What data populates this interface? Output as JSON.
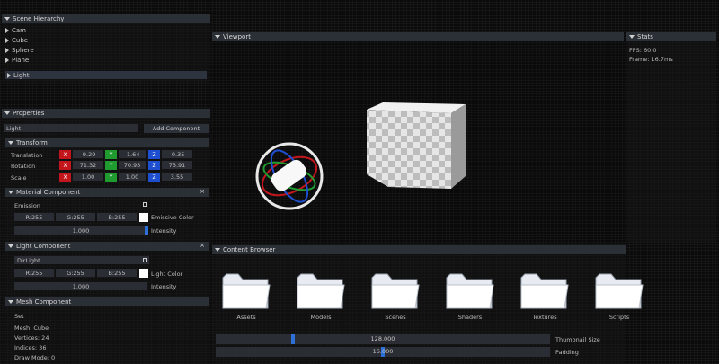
{
  "hierarchy": {
    "title": "Scene Hierarchy",
    "items": [
      "Cam",
      "Cube",
      "Sphere",
      "Plane",
      "Light"
    ]
  },
  "properties": {
    "title": "Properties",
    "object_name": "Light",
    "add_component": "Add Component",
    "transform": {
      "title": "Transform",
      "rows": [
        {
          "label": "Translation",
          "x": "-9.29",
          "y": "-1.64",
          "z": "-0.35"
        },
        {
          "label": "Rotation",
          "x": "71.32",
          "y": "70.93",
          "z": "73.91"
        },
        {
          "label": "Scale",
          "x": "1.00",
          "y": "1.00",
          "z": "3.55"
        }
      ]
    },
    "material": {
      "title": "Material Component",
      "emission_label": "Emission",
      "r": "R:255",
      "g": "G:255",
      "b": "B:255",
      "right_label": "Emissive Color",
      "value": "1.000",
      "value_label": "Intensity"
    },
    "light": {
      "title": "Light Component",
      "type": "DirLight",
      "r": "R:255",
      "g": "G:255",
      "b": "B:255",
      "right_label": "Light Color",
      "value": "1.000",
      "value_label": "Intensity"
    },
    "mesh": {
      "title": "Mesh Component",
      "set_label": "Set",
      "lines": [
        "Mesh: Cube",
        "Vertices: 24",
        "Indices: 36",
        "Draw Mode: 0"
      ]
    }
  },
  "viewport": {
    "title": "Viewport"
  },
  "stats": {
    "title": "Stats",
    "lines": [
      "FPS: 60.0",
      "Frame: 16.7ms"
    ]
  },
  "content_browser": {
    "title": "Content Browser",
    "folders": [
      "Assets",
      "Models",
      "Scenes",
      "Shaders",
      "Textures",
      "Scripts"
    ],
    "slider1": {
      "value": "128.000",
      "label": "Thumbnail Size",
      "fraction": 0.2
    },
    "slider2": {
      "value": "16.000",
      "label": "Padding",
      "fraction": 0.5
    }
  },
  "colors": {
    "header": "#2b2f36",
    "x_axis": "#c3161c",
    "y_axis": "#1f9b30",
    "z_axis": "#1e4fd1",
    "accent": "#2d6fd6"
  }
}
